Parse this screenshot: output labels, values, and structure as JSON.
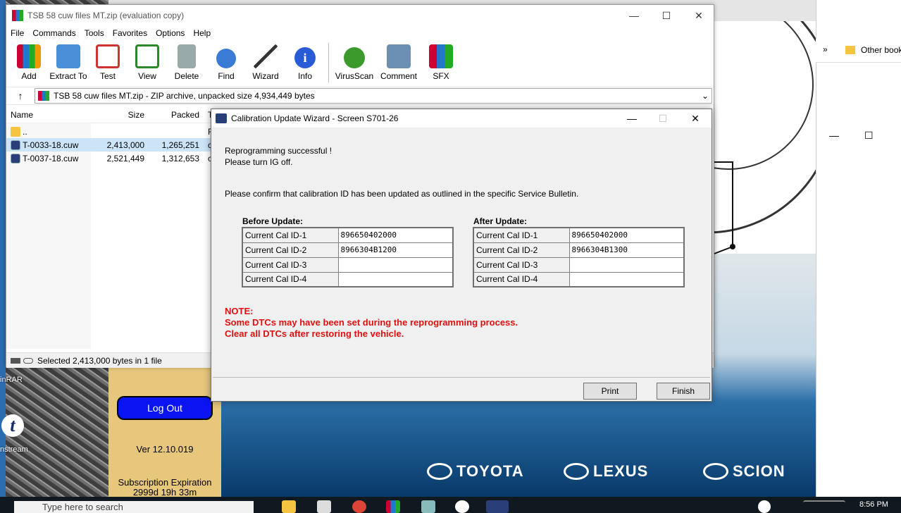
{
  "desktop": {
    "labels": [
      "inRAR",
      "nstream"
    ]
  },
  "tis": {
    "logout_label": "Log Out",
    "version": "Ver 12.10.019",
    "subscription_label": "Subscription Expiration",
    "subscription_value": "2999d 19h 33m",
    "brands": [
      "TOYOTA",
      "LEXUS",
      "SCION"
    ]
  },
  "chrome": {
    "bookmark_label": "Other book",
    "overflow": "»"
  },
  "winrar": {
    "title": "TSB 58 cuw files MT.zip (evaluation copy)",
    "menu": [
      "File",
      "Commands",
      "Tools",
      "Favorites",
      "Options",
      "Help"
    ],
    "toolbar": [
      {
        "label": "Add",
        "icon": "books-icon"
      },
      {
        "label": "Extract To",
        "icon": "folder-extract-icon"
      },
      {
        "label": "Test",
        "icon": "clipboard-test-icon"
      },
      {
        "label": "View",
        "icon": "book-view-icon"
      },
      {
        "label": "Delete",
        "icon": "trash-icon"
      },
      {
        "label": "Find",
        "icon": "magnifier-icon"
      },
      {
        "label": "Wizard",
        "icon": "wand-icon"
      },
      {
        "label": "Info",
        "icon": "info-icon"
      },
      {
        "label": "VirusScan",
        "icon": "bug-icon"
      },
      {
        "label": "Comment",
        "icon": "comment-icon"
      },
      {
        "label": "SFX",
        "icon": "sfx-icon"
      }
    ],
    "address": "TSB 58 cuw files MT.zip - ZIP archive, unpacked size 4,934,449 bytes",
    "columns": {
      "name": "Name",
      "size": "Size",
      "packed": "Packed",
      "type": "T"
    },
    "files": [
      {
        "name": "..",
        "size": "",
        "packed": "",
        "type": "F"
      },
      {
        "name": "T-0033-18.cuw",
        "size": "2,413,000",
        "packed": "1,265,251",
        "type": "c"
      },
      {
        "name": "T-0037-18.cuw",
        "size": "2,521,449",
        "packed": "1,312,653",
        "type": "c"
      }
    ],
    "status": "Selected 2,413,000 bytes in 1 file",
    "colors": {
      "selected_row": "#cce4f7"
    }
  },
  "dialog": {
    "title": "Calibration Update Wizard - Screen S701-26",
    "line1": "Reprogramming successful !",
    "line2": "Please turn IG off.",
    "confirm": "Please confirm that calibration ID has been updated as outlined in the specific Service Bulletin.",
    "before_header": "Before Update:",
    "after_header": "After Update:",
    "before_rows": [
      {
        "label": "Current Cal ID-1",
        "value": "896650402000"
      },
      {
        "label": "Current Cal ID-2",
        "value": "8966304B1200"
      },
      {
        "label": "Current Cal ID-3",
        "value": ""
      },
      {
        "label": "Current Cal ID-4",
        "value": ""
      }
    ],
    "after_rows": [
      {
        "label": "Current Cal ID-1",
        "value": "896650402000"
      },
      {
        "label": "Current Cal ID-2",
        "value": "8966304B1300"
      },
      {
        "label": "Current Cal ID-3",
        "value": ""
      },
      {
        "label": "Current Cal ID-4",
        "value": ""
      }
    ],
    "note_title": "NOTE:",
    "note_line1": "Some DTCs may have been set during the reprogramming process.",
    "note_line2": "Clear all DTCs after restoring the vehicle.",
    "print_label": "Print",
    "finish_label": "Finish",
    "colors": {
      "note": "#e01010"
    }
  },
  "taskbar": {
    "search_placeholder": "Type here to search",
    "time": "8:56 PM"
  }
}
